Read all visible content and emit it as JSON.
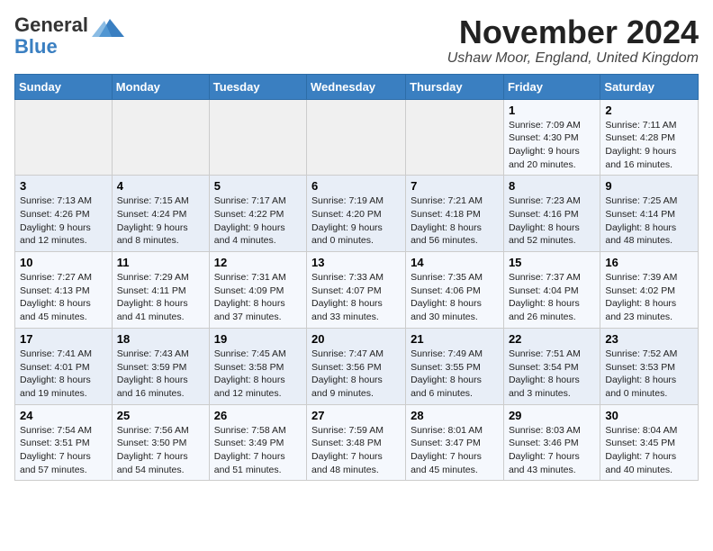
{
  "header": {
    "logo_general": "General",
    "logo_blue": "Blue",
    "month_title": "November 2024",
    "location": "Ushaw Moor, England, United Kingdom"
  },
  "days_of_week": [
    "Sunday",
    "Monday",
    "Tuesday",
    "Wednesday",
    "Thursday",
    "Friday",
    "Saturday"
  ],
  "weeks": [
    [
      {
        "day": "",
        "info": ""
      },
      {
        "day": "",
        "info": ""
      },
      {
        "day": "",
        "info": ""
      },
      {
        "day": "",
        "info": ""
      },
      {
        "day": "",
        "info": ""
      },
      {
        "day": "1",
        "info": "Sunrise: 7:09 AM\nSunset: 4:30 PM\nDaylight: 9 hours and 20 minutes."
      },
      {
        "day": "2",
        "info": "Sunrise: 7:11 AM\nSunset: 4:28 PM\nDaylight: 9 hours and 16 minutes."
      }
    ],
    [
      {
        "day": "3",
        "info": "Sunrise: 7:13 AM\nSunset: 4:26 PM\nDaylight: 9 hours and 12 minutes."
      },
      {
        "day": "4",
        "info": "Sunrise: 7:15 AM\nSunset: 4:24 PM\nDaylight: 9 hours and 8 minutes."
      },
      {
        "day": "5",
        "info": "Sunrise: 7:17 AM\nSunset: 4:22 PM\nDaylight: 9 hours and 4 minutes."
      },
      {
        "day": "6",
        "info": "Sunrise: 7:19 AM\nSunset: 4:20 PM\nDaylight: 9 hours and 0 minutes."
      },
      {
        "day": "7",
        "info": "Sunrise: 7:21 AM\nSunset: 4:18 PM\nDaylight: 8 hours and 56 minutes."
      },
      {
        "day": "8",
        "info": "Sunrise: 7:23 AM\nSunset: 4:16 PM\nDaylight: 8 hours and 52 minutes."
      },
      {
        "day": "9",
        "info": "Sunrise: 7:25 AM\nSunset: 4:14 PM\nDaylight: 8 hours and 48 minutes."
      }
    ],
    [
      {
        "day": "10",
        "info": "Sunrise: 7:27 AM\nSunset: 4:13 PM\nDaylight: 8 hours and 45 minutes."
      },
      {
        "day": "11",
        "info": "Sunrise: 7:29 AM\nSunset: 4:11 PM\nDaylight: 8 hours and 41 minutes."
      },
      {
        "day": "12",
        "info": "Sunrise: 7:31 AM\nSunset: 4:09 PM\nDaylight: 8 hours and 37 minutes."
      },
      {
        "day": "13",
        "info": "Sunrise: 7:33 AM\nSunset: 4:07 PM\nDaylight: 8 hours and 33 minutes."
      },
      {
        "day": "14",
        "info": "Sunrise: 7:35 AM\nSunset: 4:06 PM\nDaylight: 8 hours and 30 minutes."
      },
      {
        "day": "15",
        "info": "Sunrise: 7:37 AM\nSunset: 4:04 PM\nDaylight: 8 hours and 26 minutes."
      },
      {
        "day": "16",
        "info": "Sunrise: 7:39 AM\nSunset: 4:02 PM\nDaylight: 8 hours and 23 minutes."
      }
    ],
    [
      {
        "day": "17",
        "info": "Sunrise: 7:41 AM\nSunset: 4:01 PM\nDaylight: 8 hours and 19 minutes."
      },
      {
        "day": "18",
        "info": "Sunrise: 7:43 AM\nSunset: 3:59 PM\nDaylight: 8 hours and 16 minutes."
      },
      {
        "day": "19",
        "info": "Sunrise: 7:45 AM\nSunset: 3:58 PM\nDaylight: 8 hours and 12 minutes."
      },
      {
        "day": "20",
        "info": "Sunrise: 7:47 AM\nSunset: 3:56 PM\nDaylight: 8 hours and 9 minutes."
      },
      {
        "day": "21",
        "info": "Sunrise: 7:49 AM\nSunset: 3:55 PM\nDaylight: 8 hours and 6 minutes."
      },
      {
        "day": "22",
        "info": "Sunrise: 7:51 AM\nSunset: 3:54 PM\nDaylight: 8 hours and 3 minutes."
      },
      {
        "day": "23",
        "info": "Sunrise: 7:52 AM\nSunset: 3:53 PM\nDaylight: 8 hours and 0 minutes."
      }
    ],
    [
      {
        "day": "24",
        "info": "Sunrise: 7:54 AM\nSunset: 3:51 PM\nDaylight: 7 hours and 57 minutes."
      },
      {
        "day": "25",
        "info": "Sunrise: 7:56 AM\nSunset: 3:50 PM\nDaylight: 7 hours and 54 minutes."
      },
      {
        "day": "26",
        "info": "Sunrise: 7:58 AM\nSunset: 3:49 PM\nDaylight: 7 hours and 51 minutes."
      },
      {
        "day": "27",
        "info": "Sunrise: 7:59 AM\nSunset: 3:48 PM\nDaylight: 7 hours and 48 minutes."
      },
      {
        "day": "28",
        "info": "Sunrise: 8:01 AM\nSunset: 3:47 PM\nDaylight: 7 hours and 45 minutes."
      },
      {
        "day": "29",
        "info": "Sunrise: 8:03 AM\nSunset: 3:46 PM\nDaylight: 7 hours and 43 minutes."
      },
      {
        "day": "30",
        "info": "Sunrise: 8:04 AM\nSunset: 3:45 PM\nDaylight: 7 hours and 40 minutes."
      }
    ]
  ]
}
